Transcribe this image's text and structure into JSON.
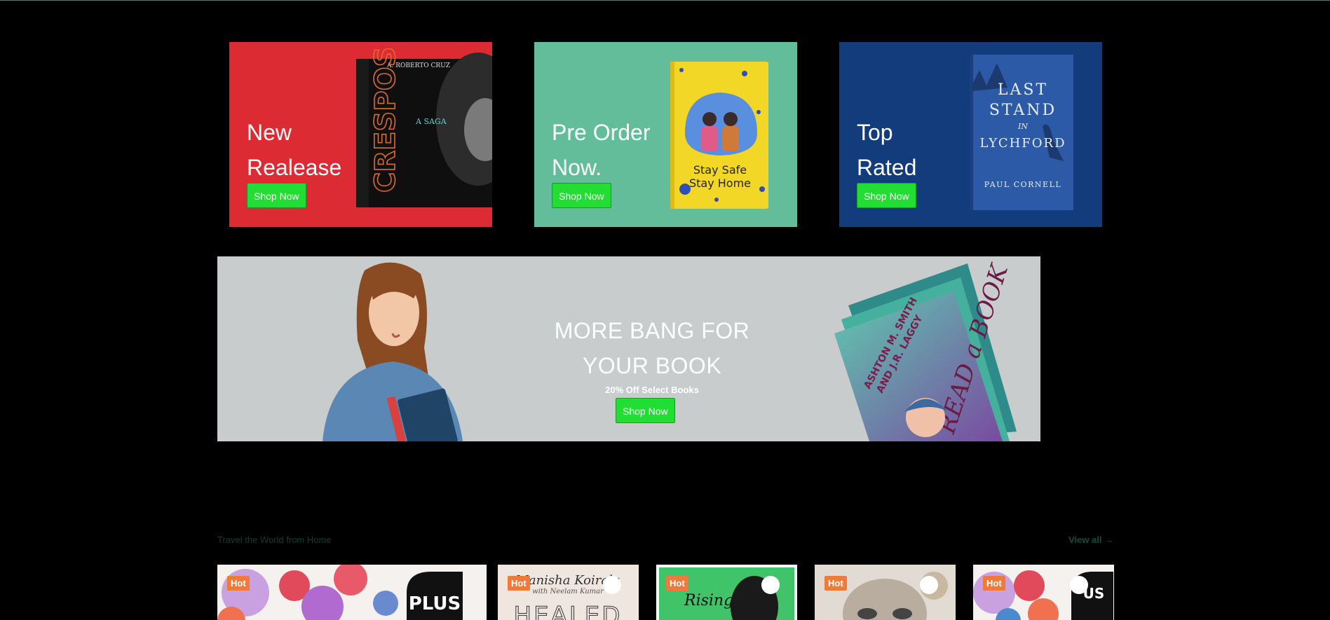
{
  "promos": [
    {
      "title": "New\nRealease",
      "button": "Shop Now",
      "bg": "#dc2b33",
      "book_author": "A. ROBERTO CRUZ",
      "book_title": "CRESPOS",
      "book_sub": "A SAGA"
    },
    {
      "title": "Pre Order\nNow.",
      "button": "Shop Now",
      "bg": "#63bd9b",
      "book_title": "Stay Safe\nStay Home"
    },
    {
      "title": "Top\nRated",
      "button": "Shop Now",
      "bg": "#123c7b",
      "book_title": "LAST\nSTAND\nIN\nLYCHFORD",
      "book_author": "PAUL CORNELL"
    }
  ],
  "banner": {
    "headline": "MORE BANG FOR\nYOUR BOOK",
    "subtext": "20% Off Select Books",
    "button": "Shop Now",
    "book_authors": "ASHTON M. SMITH\nAND J.R. LAGGY",
    "book_title": "READ a BOOK"
  },
  "section": {
    "title": "Travel the World from Home",
    "view_all": "View all →"
  },
  "products": [
    {
      "badge": "Hot",
      "cover_text": "PLUS"
    },
    {
      "badge": "Hot",
      "cover_text": "HEALED",
      "author": "Manisha Koirala",
      "coauthor": "with Neelam Kumar"
    },
    {
      "badge": "Hot",
      "cover_text": "Rising"
    },
    {
      "badge": "Hot",
      "cover_text": ""
    },
    {
      "badge": "Hot",
      "cover_text": "US"
    }
  ],
  "colors": {
    "button": "#22dd33",
    "badge": "#f07a3a"
  }
}
